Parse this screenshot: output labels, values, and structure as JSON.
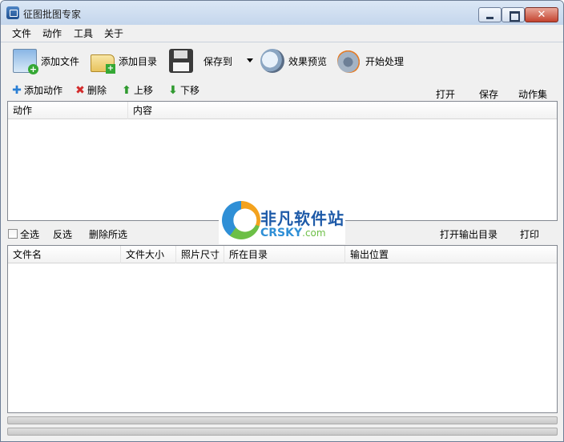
{
  "window": {
    "title": "征图批图专家"
  },
  "menu": [
    "文件",
    "动作",
    "工具",
    "关于"
  ],
  "toolbar": {
    "add_file": "添加文件",
    "add_dir": "添加目录",
    "save_to": "保存到",
    "preview": "效果预览",
    "start": "开始处理"
  },
  "actions": {
    "add": "添加动作",
    "delete": "删除",
    "up": "上移",
    "down": "下移",
    "open": "打开",
    "save": "保存",
    "action_set": "动作集"
  },
  "action_table": {
    "columns": [
      "动作",
      "内容"
    ]
  },
  "selection": {
    "select_all": "全选",
    "invert": "反选",
    "delete_selected": "删除所选",
    "open_output_dir": "打开输出目录",
    "print": "打印"
  },
  "file_table": {
    "columns": [
      "文件名",
      "文件大小",
      "照片尺寸",
      "所在目录",
      "输出位置"
    ]
  },
  "watermark": {
    "cn": "非凡软件站",
    "en": "CRSKY",
    "domain": ".com"
  }
}
